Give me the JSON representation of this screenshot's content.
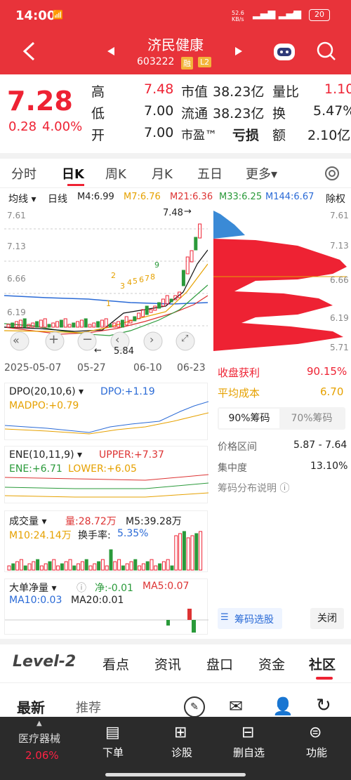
{
  "status": {
    "time": "14:00",
    "speed": "52.6\nKB/s",
    "battery": "20"
  },
  "header": {
    "name": "济民健康",
    "code": "603222",
    "tag1": "融",
    "tag2": "L2"
  },
  "quote": {
    "price": "7.28",
    "change": "0.28",
    "pct": "4.00%",
    "rows": [
      {
        "l1": "高",
        "v1": "7.48",
        "l2": "市值",
        "v2": "38.23亿",
        "l3": "量比",
        "v3": "1.10"
      },
      {
        "l1": "低",
        "v1": "7.00",
        "l2": "流通",
        "v2": "38.23亿",
        "l3": "换",
        "v3": "5.47%"
      },
      {
        "l1": "开",
        "v1": "7.00",
        "l2": "市盈™",
        "v2": "亏损",
        "l3": "额",
        "v3": "2.10亿"
      }
    ]
  },
  "tabs": [
    "分时",
    "日K",
    "周K",
    "月K",
    "五日",
    "更多▾"
  ],
  "kline": {
    "type": "均线 ▾",
    "period": "日线",
    "m4": "M4:6.99",
    "m7": "M7:6.76",
    "m21": "M21:6.36",
    "m33": "M33:6.25",
    "m144": "M144:6.67",
    "rights": "除权",
    "y_ticks": [
      "7.61",
      "7.13",
      "6.66",
      "6.19"
    ],
    "high": "7.48",
    "low": "5.84",
    "dates": [
      "2025-05-07",
      "05-27",
      "06-10",
      "06-23"
    ],
    "nums": [
      "1",
      "2",
      "3",
      "4",
      "5",
      "6",
      "7",
      "8",
      "9"
    ]
  },
  "chips": {
    "y": [
      "7.61",
      "7.13",
      "6.66",
      "6.19",
      "5.71"
    ],
    "profit_label": "收盘获利",
    "profit": "90.15%",
    "cost_label": "平均成本",
    "cost": "6.70",
    "tab90": "90%筹码",
    "tab70": "70%筹码",
    "range_label": "价格区间",
    "range": "5.87 - 7.64",
    "conc_label": "集中度",
    "conc": "13.10%",
    "explain": "筹码分布说明 ⓘ",
    "select": "筹码选股",
    "close": "关闭"
  },
  "dpo": {
    "title": "DPO(20,10,6) ▾",
    "dpo": "DPO:+1.19",
    "madpo": "MADPO:+0.79"
  },
  "ene": {
    "title": "ENE(10,11,9) ▾",
    "upper": "UPPER:+7.37",
    "ene": "ENE:+6.71",
    "lower": "LOWER:+6.05"
  },
  "vol": {
    "title": "成交量 ▾",
    "vol": "量:28.72万",
    "m5": "M5:39.28万",
    "m10": "M10:24.14万",
    "turn": "换手率:",
    "turnv": "5.35%"
  },
  "big": {
    "title": "大单净量 ▾",
    "net": "净:-0.01",
    "ma5": "MA5:0.07",
    "ma10": "MA10:0.03",
    "ma20": "MA20:0.01"
  },
  "section": {
    "level2": "Level-2",
    "tabs": [
      "看点",
      "资讯",
      "盘口",
      "资金",
      "社区"
    ]
  },
  "feed": {
    "tabs": [
      "最新",
      "推荐"
    ]
  },
  "bottom": {
    "sector": "医疗器械",
    "sector_pct": "2.06%",
    "items": [
      "下单",
      "诊股",
      "删自选",
      "功能"
    ]
  }
}
